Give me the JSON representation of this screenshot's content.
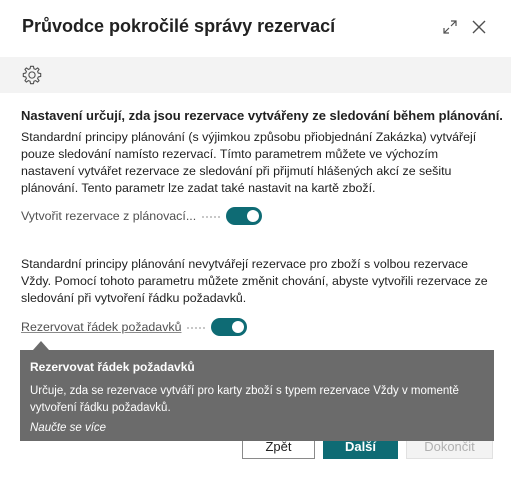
{
  "dialog": {
    "title": "Průvodce pokročilé správy rezervací",
    "expand_icon": "expand-icon",
    "close_icon": "close-icon"
  },
  "toolbar": {
    "settings_icon": "gear-icon"
  },
  "content": {
    "heading": "Nastavení určují, zda jsou rezervace vytvářeny ze sledování během plánování.",
    "paragraph1": "Standardní principy plánování (s výjimkou způsobu přiobjednání Zakázka) vytvářejí pouze sledování namísto rezervací. Tímto parametrem můžete ve výchozím nastavení vytvářet rezervace ze sledování při přijmutí hlášených akcí ze sešitu plánování. Tento parametr lze zadat také nastavit na kartě zboží.",
    "field1_label": "Vytvořit rezervace z plánovací...",
    "field1_value": true,
    "paragraph2": "Standardní principy plánování nevytvářejí rezervace pro zboží s volbou rezervace Vždy. Pomocí tohoto parametru můžete změnit chování, abyste vytvořili rezervace ze sledování při vytvoření řádku požadavků.",
    "field2_label": "Rezervovat řádek požadavků",
    "field2_value": true
  },
  "tooltip": {
    "title": "Rezervovat řádek požadavků",
    "text": "Určuje, zda se rezervace vytváří pro karty zboží s typem rezervace Vždy v momentě vytvoření řádku požadavků.",
    "link": "Naučte se více"
  },
  "footer": {
    "back_label": "Zpět",
    "next_label": "Další",
    "finish_label": "Dokončit"
  },
  "colors": {
    "accent": "#0e6b74",
    "tooltip_bg": "#6b6b6b"
  }
}
